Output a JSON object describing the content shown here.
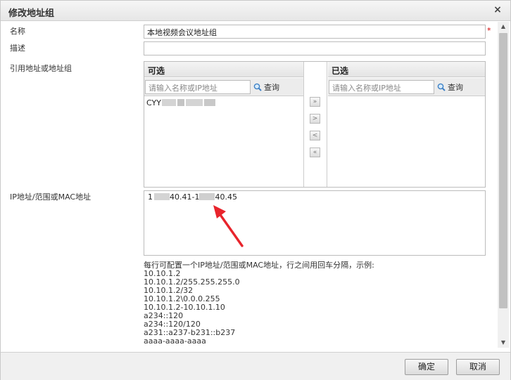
{
  "dialog": {
    "title": "修改地址组",
    "close_glyph": "×"
  },
  "form": {
    "name_label": "名称",
    "name_value": "本地视频会议地址组",
    "required_mark": "*",
    "desc_label": "描述",
    "desc_value": "",
    "ref_label": "引用地址或地址组",
    "ip_label": "IP地址/范围或MAC地址"
  },
  "available": {
    "header": "可选",
    "search_placeholder": "请输入名称或IP地址",
    "query_label": "查询",
    "items": [
      {
        "prefix": "CYY"
      }
    ]
  },
  "selected": {
    "header": "已选",
    "search_placeholder": "请输入名称或IP地址",
    "query_label": "查询"
  },
  "transfer": {
    "add_all": "»",
    "add_one": ">",
    "remove_one": "<",
    "remove_all": "«"
  },
  "ip_entry": {
    "part1": "1",
    "part2": "40.41-1",
    "part3": "40.45"
  },
  "hint": {
    "intro": "每行可配置一个IP地址/范围或MAC地址，行之间用回车分隔，示例:",
    "examples": [
      "10.10.1.2",
      "10.10.1.2/255.255.255.0",
      "10.10.1.2/32",
      "10.10.1.2\\0.0.0.255",
      "10.10.1.2-10.10.1.10",
      "a234::120",
      "a234::120/120",
      "a231::a237-b231::b237",
      "aaaa-aaaa-aaaa"
    ]
  },
  "buttons": {
    "confirm": "确定",
    "cancel": "取消"
  },
  "colors": {
    "annotation_arrow": "#e8242c",
    "required": "#d40000"
  }
}
